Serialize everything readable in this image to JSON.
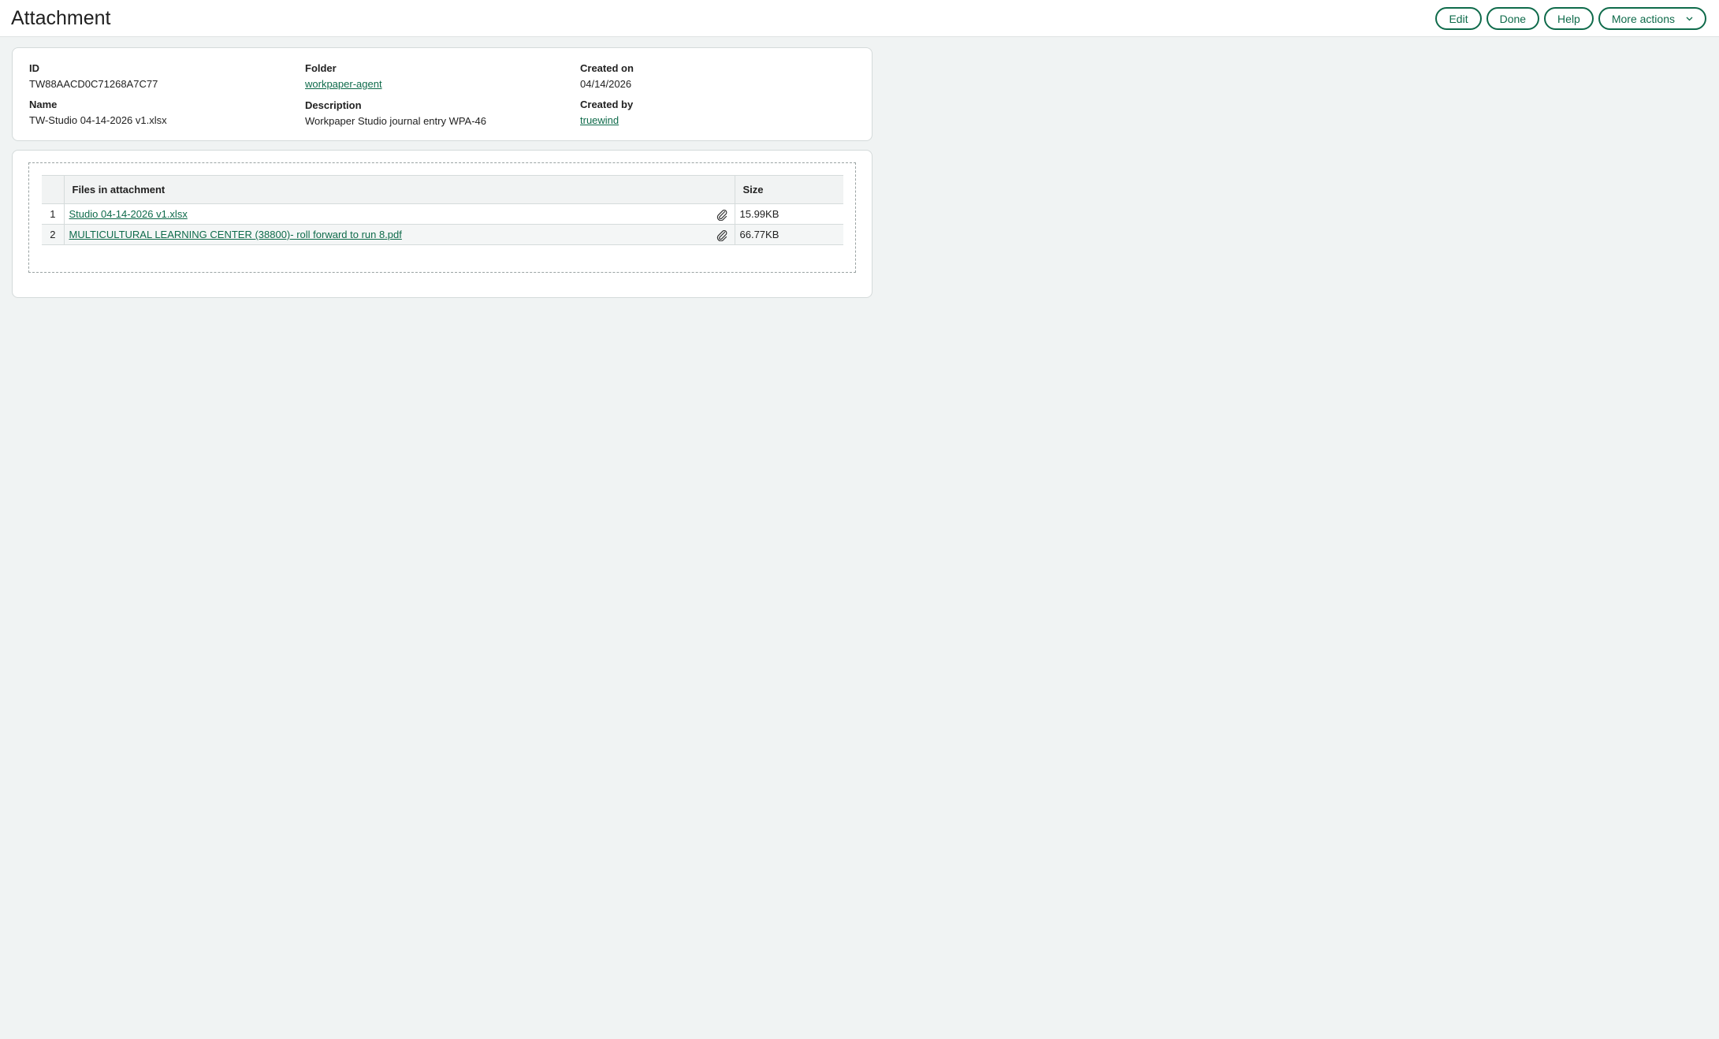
{
  "header": {
    "title": "Attachment",
    "buttons": {
      "edit": "Edit",
      "done": "Done",
      "help": "Help",
      "more_actions": "More actions"
    }
  },
  "details": {
    "id_label": "ID",
    "id_value": "TW88AACD0C71268A7C77",
    "folder_label": "Folder",
    "folder_value": "workpaper-agent",
    "created_on_label": "Created on",
    "created_on_value": "04/14/2026",
    "name_label": "Name",
    "name_value": "TW-Studio 04-14-2026 v1.xlsx",
    "description_label": "Description",
    "description_value": "Workpaper Studio journal entry WPA-46",
    "created_by_label": "Created by",
    "created_by_value": "truewind"
  },
  "files_table": {
    "headers": {
      "files": "Files in attachment",
      "size": "Size"
    },
    "rows": [
      {
        "index": "1",
        "name": "Studio 04-14-2026 v1.xlsx",
        "size": "15.99KB"
      },
      {
        "index": "2",
        "name": "MULTICULTURAL LEARNING CENTER (38800)- roll forward to run 8.pdf",
        "size": "66.77KB"
      }
    ]
  },
  "icons": {
    "attachment": "paperclip-icon",
    "dropdown": "chevron-down-icon"
  },
  "colors": {
    "accent": "#0f6b4b",
    "background": "#f0f3f3"
  }
}
